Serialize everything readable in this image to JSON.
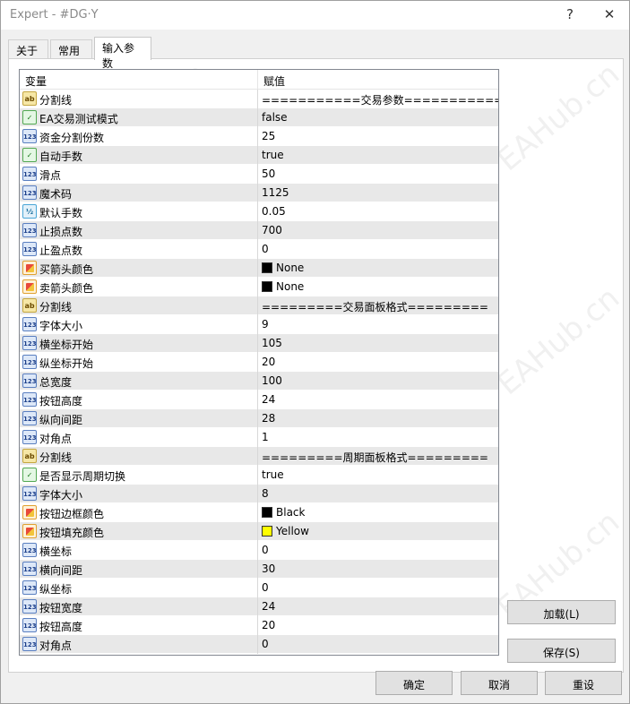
{
  "window": {
    "title": "Expert - #DG·Y",
    "help_glyph": "?",
    "close_glyph": "✕"
  },
  "tabs": [
    {
      "label": "关于",
      "active": false
    },
    {
      "label": "常用",
      "active": false
    },
    {
      "label": "输入参数",
      "active": true
    }
  ],
  "grid": {
    "col_variable": "变量",
    "col_value": "赋值",
    "rows": [
      {
        "icon": "ab",
        "name": "分割线",
        "value": "===========交易参数==========="
      },
      {
        "icon": "bool",
        "name": "EA交易测试模式",
        "value": "false"
      },
      {
        "icon": "int",
        "name": "资金分割份数",
        "value": "25"
      },
      {
        "icon": "bool",
        "name": "自动手数",
        "value": "true"
      },
      {
        "icon": "int",
        "name": "滑点",
        "value": "50"
      },
      {
        "icon": "int",
        "name": "魔术码",
        "value": "1125"
      },
      {
        "icon": "dbl",
        "name": "默认手数",
        "value": "0.05"
      },
      {
        "icon": "int",
        "name": "止损点数",
        "value": "700"
      },
      {
        "icon": "int",
        "name": "止盈点数",
        "value": "0"
      },
      {
        "icon": "clr",
        "name": "买箭头颜色",
        "value": "None",
        "swatch": "#000000"
      },
      {
        "icon": "clr",
        "name": "卖箭头颜色",
        "value": "None",
        "swatch": "#000000"
      },
      {
        "icon": "ab",
        "name": "分割线",
        "value": "=========交易面板格式========="
      },
      {
        "icon": "int",
        "name": "字体大小",
        "value": "9"
      },
      {
        "icon": "int",
        "name": "横坐标开始",
        "value": "105"
      },
      {
        "icon": "int",
        "name": "纵坐标开始",
        "value": "20"
      },
      {
        "icon": "int",
        "name": "总宽度",
        "value": "100"
      },
      {
        "icon": "int",
        "name": "按钮高度",
        "value": "24"
      },
      {
        "icon": "int",
        "name": "纵向间距",
        "value": "28"
      },
      {
        "icon": "int",
        "name": "对角点",
        "value": "1"
      },
      {
        "icon": "ab",
        "name": "分割线",
        "value": "=========周期面板格式========="
      },
      {
        "icon": "bool",
        "name": "是否显示周期切换",
        "value": "true"
      },
      {
        "icon": "int",
        "name": "字体大小",
        "value": "8"
      },
      {
        "icon": "clr",
        "name": "按钮边框颜色",
        "value": "Black",
        "swatch": "#000000"
      },
      {
        "icon": "clr",
        "name": "按钮填充颜色",
        "value": "Yellow",
        "swatch": "#ffff00"
      },
      {
        "icon": "int",
        "name": "横坐标",
        "value": "0"
      },
      {
        "icon": "int",
        "name": "横向间距",
        "value": "30"
      },
      {
        "icon": "int",
        "name": "纵坐标",
        "value": "0"
      },
      {
        "icon": "int",
        "name": "按钮宽度",
        "value": "24"
      },
      {
        "icon": "int",
        "name": "按钮高度",
        "value": "20"
      },
      {
        "icon": "int",
        "name": "对角点",
        "value": "0"
      }
    ]
  },
  "icons": {
    "ab": "ab",
    "bool": "✓",
    "int": "123",
    "dbl": "½",
    "clr": ""
  },
  "buttons": {
    "load": "加载(L)",
    "save": "保存(S)",
    "ok": "确定",
    "cancel": "取消",
    "reset": "重设"
  },
  "watermark": "EAHub.cn"
}
